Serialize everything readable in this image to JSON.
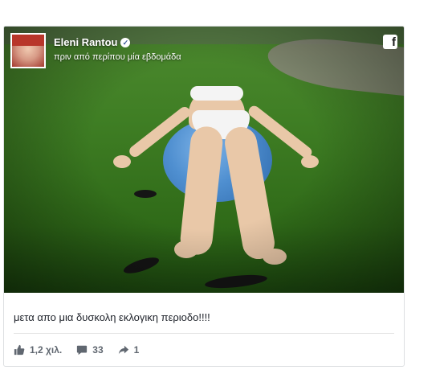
{
  "post": {
    "author": "Eleni Rantou",
    "timestamp": "πριν από περίπου μία εβδομάδα",
    "caption": "μετα απο μια δυσκολη εκλογικη περιοδο!!!!",
    "likes": "1,2 χιλ.",
    "comments": "33",
    "shares": "1"
  },
  "icons": {
    "verified": "verified-badge-icon",
    "brand": "facebook-icon",
    "like": "thumbs-up-icon",
    "comment": "comment-icon",
    "share": "share-arrow-icon"
  },
  "colors": {
    "brand": "#3b5998",
    "meta_text": "#606770",
    "border": "#dddfe2"
  }
}
